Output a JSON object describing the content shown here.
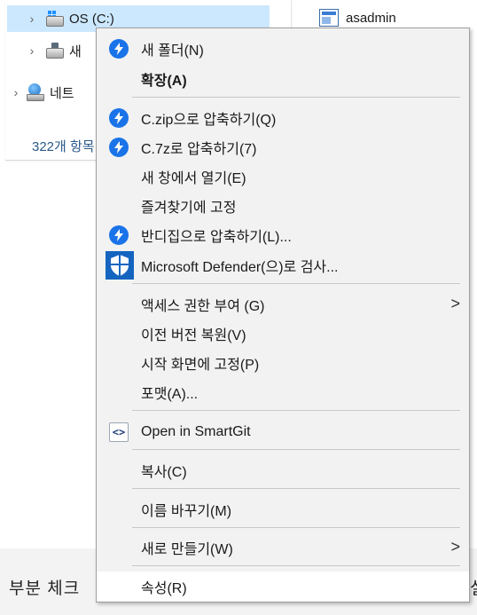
{
  "navigation_pane": {
    "items": [
      {
        "label": "OS (C:)",
        "icon": "windows-drive-icon",
        "selected": true
      },
      {
        "label": "새",
        "icon": "network-drive-icon",
        "selected": false
      },
      {
        "label": "네트",
        "icon": "network-icon",
        "selected": false
      }
    ],
    "item_count": "322개 항목"
  },
  "file_list": {
    "visible_file": "asadmin"
  },
  "status_area": {
    "partial_text": "부분 체크",
    "partial_right": "설"
  },
  "context_menu": {
    "items": [
      {
        "label": "새 폴더(N)",
        "icon": "bandizip-icon"
      },
      {
        "label": "확장(A)",
        "bold": true
      },
      {
        "label": "C.zip으로 압축하기(Q)",
        "icon": "bandizip-icon"
      },
      {
        "label": "C.7z로 압축하기(7)",
        "icon": "bandizip-icon"
      },
      {
        "label": "새 창에서 열기(E)"
      },
      {
        "label": "즐겨찾기에 고정"
      },
      {
        "label": "반디집으로 압축하기(L)...",
        "icon": "bandizip-icon"
      },
      {
        "label": "Microsoft Defender(으)로 검사...",
        "icon": "defender-shield-icon"
      },
      {
        "label": "액세스 권한 부여 (G)",
        "submenu": true
      },
      {
        "label": "이전 버전 복원(V)"
      },
      {
        "label": "시작 화면에 고정(P)"
      },
      {
        "label": "포맷(A)..."
      },
      {
        "label": "Open in SmartGit",
        "icon": "smartgit-icon"
      },
      {
        "label": "복사(C)"
      },
      {
        "label": "이름 바꾸기(M)"
      },
      {
        "label": "새로 만들기(W)",
        "submenu": true
      },
      {
        "label": "속성(R)",
        "highlighted": true
      }
    ],
    "submenu_glyph": ">",
    "smartgit_glyph": "<>"
  },
  "colors": {
    "menu_background": "#f2f2f2",
    "selection": "#cce8ff",
    "bandizip_blue": "#1a73e8",
    "defender_blue": "#1565c0"
  }
}
